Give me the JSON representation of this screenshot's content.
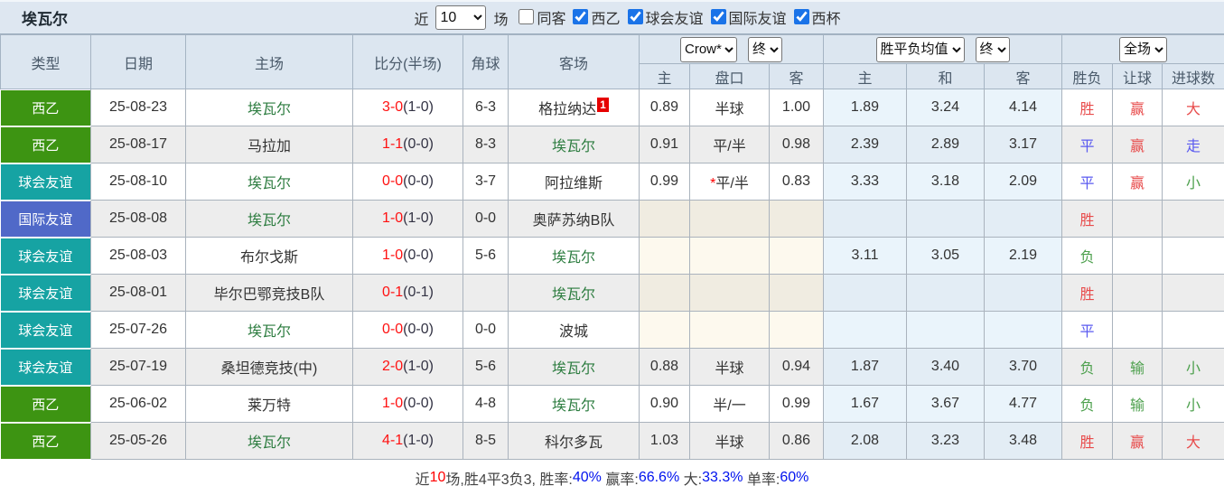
{
  "top_bar": {
    "team_title": "埃瓦尔",
    "near_label": "近",
    "matches_value": "10",
    "matches_suffix": "场",
    "filters": [
      {
        "label": "同客",
        "checked": false
      },
      {
        "label": "西乙",
        "checked": true
      },
      {
        "label": "球会友谊",
        "checked": true
      },
      {
        "label": "国际友谊",
        "checked": true
      },
      {
        "label": "西杯",
        "checked": true
      }
    ]
  },
  "header": {
    "static_cols": [
      "类型",
      "日期",
      "主场",
      "比分(半场)",
      "角球",
      "客场"
    ],
    "book_select": "Crow*",
    "time_select_1": "终",
    "odds_select": "胜平负均值",
    "time_select_2": "终",
    "scope_select": "全场",
    "sub_cols": [
      "主",
      "盘口",
      "客",
      "主",
      "和",
      "客",
      "胜负",
      "让球",
      "进球数"
    ]
  },
  "colors": {
    "league": "#3d9412",
    "club": "#16a3a3",
    "intl": "#5069c8",
    "checkbox_accent": "#1a73e8",
    "score_red": "#ff1111",
    "team_green": "#2c7c3f",
    "result_red": "#e84b4b",
    "result_blue": "#5a5af0",
    "result_green": "#4da04d",
    "summary_blue": "#0012ee"
  },
  "rows": [
    {
      "type": "西乙",
      "type_key": "league",
      "date": "25-08-23",
      "home": "埃瓦尔",
      "home_self": true,
      "score": "3-0",
      "half": "(1-0)",
      "corner": "6-3",
      "away": "格拉纳达",
      "away_self": false,
      "away_note": "1",
      "ah_home": "0.89",
      "handicap": "半球",
      "handicap_star": false,
      "ah_away": "1.00",
      "avg_home": "1.89",
      "avg_draw": "3.24",
      "avg_away": "4.14",
      "result": {
        "t": "胜",
        "c": "red"
      },
      "let_ball": {
        "t": "赢",
        "c": "red"
      },
      "goals": {
        "t": "大",
        "c": "red"
      }
    },
    {
      "type": "西乙",
      "type_key": "league",
      "date": "25-08-17",
      "home": "马拉加",
      "home_self": false,
      "score": "1-1",
      "half": "(0-0)",
      "corner": "8-3",
      "away": "埃瓦尔",
      "away_self": true,
      "away_note": "",
      "ah_home": "0.91",
      "handicap": "平/半",
      "handicap_star": false,
      "ah_away": "0.98",
      "avg_home": "2.39",
      "avg_draw": "2.89",
      "avg_away": "3.17",
      "result": {
        "t": "平",
        "c": "blue"
      },
      "let_ball": {
        "t": "赢",
        "c": "red"
      },
      "goals": {
        "t": "走",
        "c": "blue"
      }
    },
    {
      "type": "球会友谊",
      "type_key": "club",
      "date": "25-08-10",
      "home": "埃瓦尔",
      "home_self": true,
      "score": "0-0",
      "half": "(0-0)",
      "corner": "3-7",
      "away": "阿拉维斯",
      "away_self": false,
      "away_note": "",
      "ah_home": "0.99",
      "handicap": "平/半",
      "handicap_star": true,
      "ah_away": "0.83",
      "avg_home": "3.33",
      "avg_draw": "3.18",
      "avg_away": "2.09",
      "result": {
        "t": "平",
        "c": "blue"
      },
      "let_ball": {
        "t": "赢",
        "c": "red"
      },
      "goals": {
        "t": "小",
        "c": "green"
      }
    },
    {
      "type": "国际友谊",
      "type_key": "intl",
      "date": "25-08-08",
      "home": "埃瓦尔",
      "home_self": true,
      "score": "1-0",
      "half": "(1-0)",
      "corner": "0-0",
      "away": "奥萨苏纳B队",
      "away_self": false,
      "away_note": "",
      "ah_home": "",
      "handicap": "",
      "handicap_star": false,
      "ah_away": "",
      "avg_home": "",
      "avg_draw": "",
      "avg_away": "",
      "result": {
        "t": "胜",
        "c": "red"
      },
      "let_ball": {
        "t": "",
        "c": ""
      },
      "goals": {
        "t": "",
        "c": ""
      }
    },
    {
      "type": "球会友谊",
      "type_key": "club",
      "date": "25-08-03",
      "home": "布尔戈斯",
      "home_self": false,
      "score": "1-0",
      "half": "(0-0)",
      "corner": "5-6",
      "away": "埃瓦尔",
      "away_self": true,
      "away_note": "",
      "ah_home": "",
      "handicap": "",
      "handicap_star": false,
      "ah_away": "",
      "avg_home": "3.11",
      "avg_draw": "3.05",
      "avg_away": "2.19",
      "result": {
        "t": "负",
        "c": "green"
      },
      "let_ball": {
        "t": "",
        "c": ""
      },
      "goals": {
        "t": "",
        "c": ""
      }
    },
    {
      "type": "球会友谊",
      "type_key": "club",
      "date": "25-08-01",
      "home": "毕尔巴鄂竞技B队",
      "home_self": false,
      "score": "0-1",
      "half": "(0-1)",
      "corner": "",
      "away": "埃瓦尔",
      "away_self": true,
      "away_note": "",
      "ah_home": "",
      "handicap": "",
      "handicap_star": false,
      "ah_away": "",
      "avg_home": "",
      "avg_draw": "",
      "avg_away": "",
      "result": {
        "t": "胜",
        "c": "red"
      },
      "let_ball": {
        "t": "",
        "c": ""
      },
      "goals": {
        "t": "",
        "c": ""
      }
    },
    {
      "type": "球会友谊",
      "type_key": "club",
      "date": "25-07-26",
      "home": "埃瓦尔",
      "home_self": true,
      "score": "0-0",
      "half": "(0-0)",
      "corner": "0-0",
      "away": "波城",
      "away_self": false,
      "away_note": "",
      "ah_home": "",
      "handicap": "",
      "handicap_star": false,
      "ah_away": "",
      "avg_home": "",
      "avg_draw": "",
      "avg_away": "",
      "result": {
        "t": "平",
        "c": "blue"
      },
      "let_ball": {
        "t": "",
        "c": ""
      },
      "goals": {
        "t": "",
        "c": ""
      }
    },
    {
      "type": "球会友谊",
      "type_key": "club",
      "date": "25-07-19",
      "home": "桑坦德竞技(中)",
      "home_self": false,
      "score": "2-0",
      "half": "(1-0)",
      "corner": "5-6",
      "away": "埃瓦尔",
      "away_self": true,
      "away_note": "",
      "ah_home": "0.88",
      "handicap": "半球",
      "handicap_star": false,
      "ah_away": "0.94",
      "avg_home": "1.87",
      "avg_draw": "3.40",
      "avg_away": "3.70",
      "result": {
        "t": "负",
        "c": "green"
      },
      "let_ball": {
        "t": "输",
        "c": "green"
      },
      "goals": {
        "t": "小",
        "c": "green"
      }
    },
    {
      "type": "西乙",
      "type_key": "league",
      "date": "25-06-02",
      "home": "莱万特",
      "home_self": false,
      "score": "1-0",
      "half": "(0-0)",
      "corner": "4-8",
      "away": "埃瓦尔",
      "away_self": true,
      "away_note": "",
      "ah_home": "0.90",
      "handicap": "半/一",
      "handicap_star": false,
      "ah_away": "0.99",
      "avg_home": "1.67",
      "avg_draw": "3.67",
      "avg_away": "4.77",
      "result": {
        "t": "负",
        "c": "green"
      },
      "let_ball": {
        "t": "输",
        "c": "green"
      },
      "goals": {
        "t": "小",
        "c": "green"
      }
    },
    {
      "type": "西乙",
      "type_key": "league",
      "date": "25-05-26",
      "home": "埃瓦尔",
      "home_self": true,
      "score": "4-1",
      "half": "(1-0)",
      "corner": "8-5",
      "away": "科尔多瓦",
      "away_self": false,
      "away_note": "",
      "ah_home": "1.03",
      "handicap": "半球",
      "handicap_star": false,
      "ah_away": "0.86",
      "avg_home": "2.08",
      "avg_draw": "3.23",
      "avg_away": "3.48",
      "result": {
        "t": "胜",
        "c": "red"
      },
      "let_ball": {
        "t": "赢",
        "c": "red"
      },
      "goals": {
        "t": "大",
        "c": "red"
      }
    }
  ],
  "summary": {
    "segments": [
      {
        "t": "近",
        "c": "dark"
      },
      {
        "t": "10",
        "c": "red"
      },
      {
        "t": "场,胜4平3负3, 胜率:",
        "c": "dark"
      },
      {
        "t": "40%",
        "c": "blue"
      },
      {
        "t": " 赢率:",
        "c": "dark"
      },
      {
        "t": "66.6%",
        "c": "blue"
      },
      {
        "t": " 大:",
        "c": "dark"
      },
      {
        "t": "33.3%",
        "c": "blue"
      },
      {
        "t": " 单率:",
        "c": "dark"
      },
      {
        "t": "60%",
        "c": "blue"
      }
    ]
  }
}
